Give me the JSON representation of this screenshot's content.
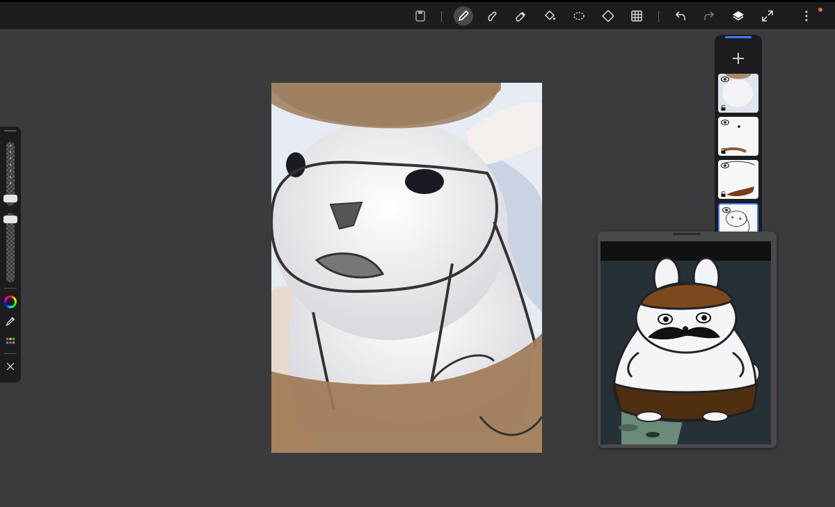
{
  "toolbar": {
    "tools": [
      {
        "name": "save-icon"
      },
      {
        "name": "brush-icon",
        "active": true
      },
      {
        "name": "smudge-icon"
      },
      {
        "name": "eraser-icon"
      },
      {
        "name": "fill-bucket-icon"
      },
      {
        "name": "lasso-select-icon"
      },
      {
        "name": "transform-icon"
      },
      {
        "name": "grid-icon"
      },
      {
        "name": "undo-icon"
      },
      {
        "name": "redo-icon"
      },
      {
        "name": "layers-icon"
      },
      {
        "name": "fullscreen-icon"
      },
      {
        "name": "more-options-icon"
      }
    ],
    "notification_color": "#e8673c"
  },
  "sidebar": {
    "brush_size_fraction": 0.44,
    "opacity_fraction": 0.53,
    "color_wheel": "color-wheel-icon",
    "eyedropper": "eyedropper-icon",
    "palette": "palette-icon",
    "close": "close-icon"
  },
  "layers": {
    "accent_color": "#3b7bff",
    "selected_index": 3,
    "items": [
      {
        "name": "photo-layer",
        "visible": true,
        "locked": true
      },
      {
        "name": "hat-color-layer",
        "visible": true,
        "locked": true
      },
      {
        "name": "pants-color-layer",
        "visible": true,
        "locked": true
      },
      {
        "name": "sketch-layer",
        "visible": true,
        "locked": true
      }
    ]
  }
}
